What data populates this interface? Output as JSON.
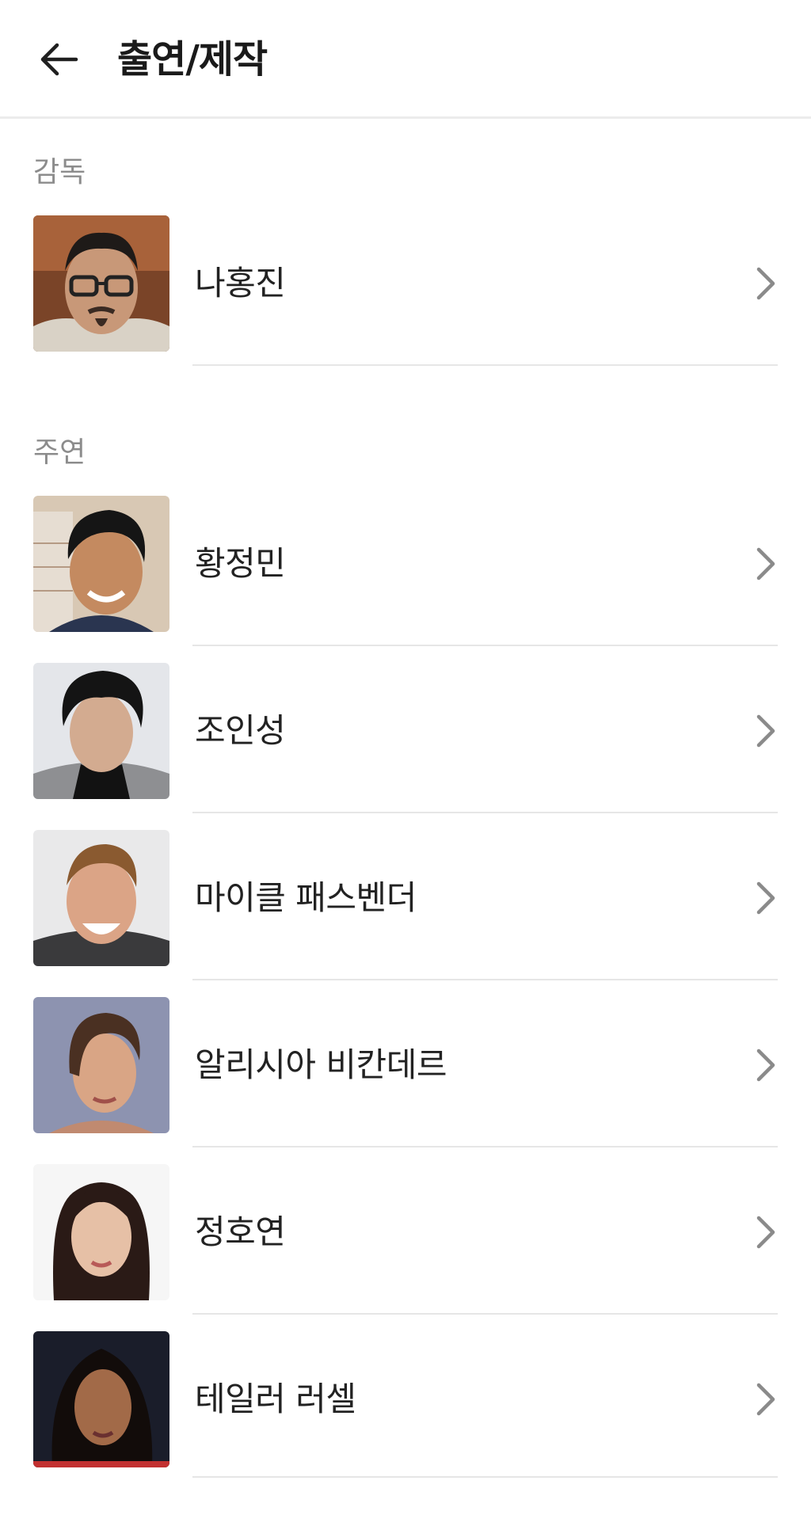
{
  "header": {
    "title": "출연/제작",
    "back_icon": "arrow-left-icon"
  },
  "sections": {
    "director": {
      "label": "감독",
      "people": [
        {
          "name": "나홍진"
        }
      ]
    },
    "cast": {
      "label": "주연",
      "people": [
        {
          "name": "황정민"
        },
        {
          "name": "조인성"
        },
        {
          "name": "마이클 패스벤더"
        },
        {
          "name": "알리시아 비칸데르"
        },
        {
          "name": "정호연"
        },
        {
          "name": "테일러 러셀"
        }
      ]
    }
  },
  "icons": {
    "row_chevron": "chevron-right-icon"
  },
  "colors": {
    "section_label": "#8c8c8c",
    "divider": "#e6e6e6",
    "chevron": "#8a8a8a"
  }
}
